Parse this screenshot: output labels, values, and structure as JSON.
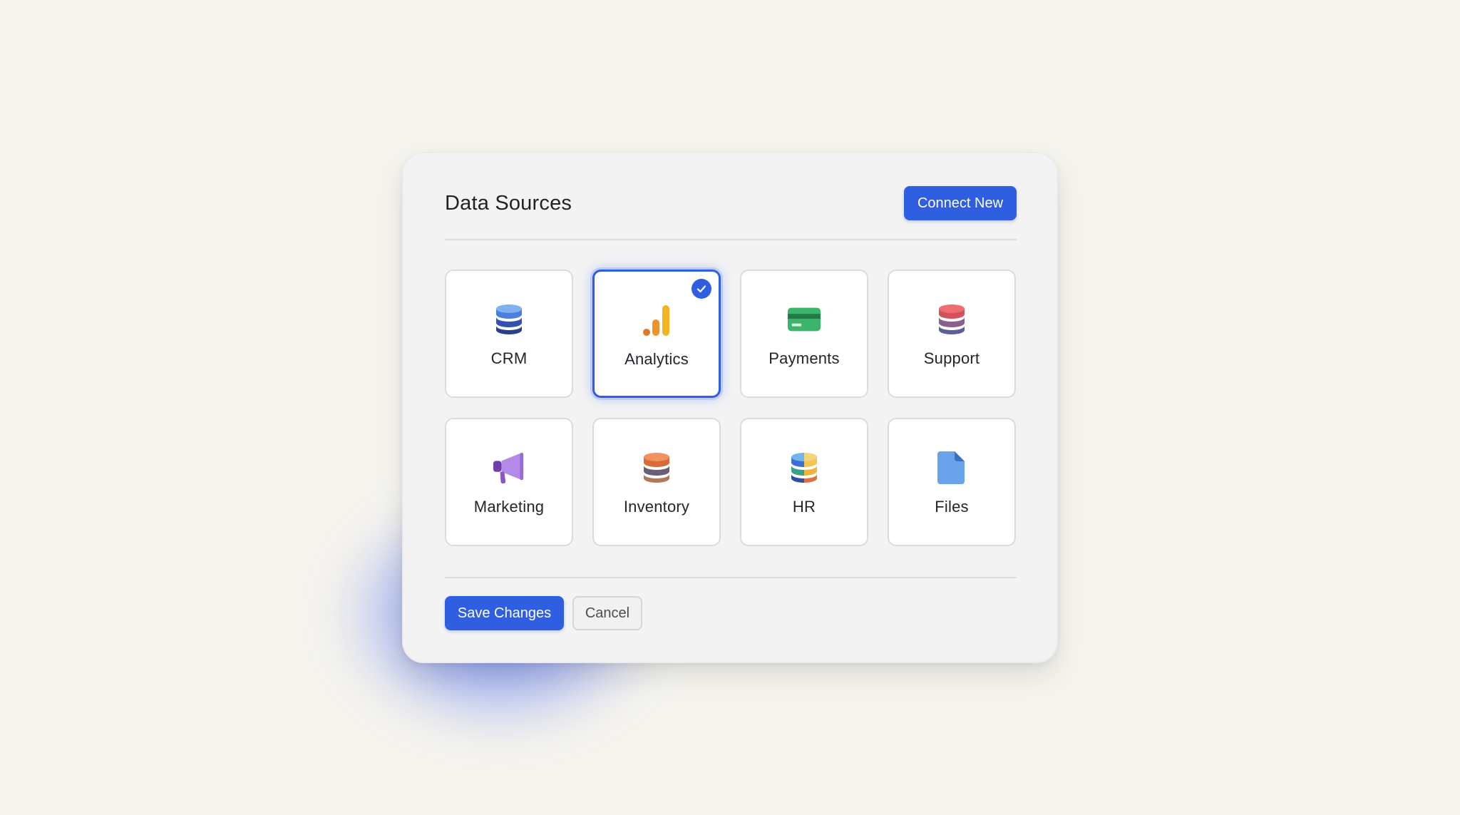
{
  "header": {
    "title": "Data Sources",
    "connect_label": "Connect New"
  },
  "sources": [
    {
      "label": "CRM",
      "icon": "database-icon",
      "selected": false
    },
    {
      "label": "Analytics",
      "icon": "bar-chart-icon",
      "selected": true
    },
    {
      "label": "Payments",
      "icon": "credit-card-icon",
      "selected": false
    },
    {
      "label": "Support",
      "icon": "database-icon",
      "selected": false
    },
    {
      "label": "Marketing",
      "icon": "megaphone-icon",
      "selected": false
    },
    {
      "label": "Inventory",
      "icon": "database-icon",
      "selected": false
    },
    {
      "label": "HR",
      "icon": "database-icon",
      "selected": false
    },
    {
      "label": "Files",
      "icon": "file-icon",
      "selected": false
    }
  ],
  "footer": {
    "save_label": "Save Changes",
    "cancel_label": "Cancel"
  },
  "colors": {
    "accent": "#2f5ee0",
    "background": "#f6f4ee",
    "panel": "#f3f3f4"
  }
}
